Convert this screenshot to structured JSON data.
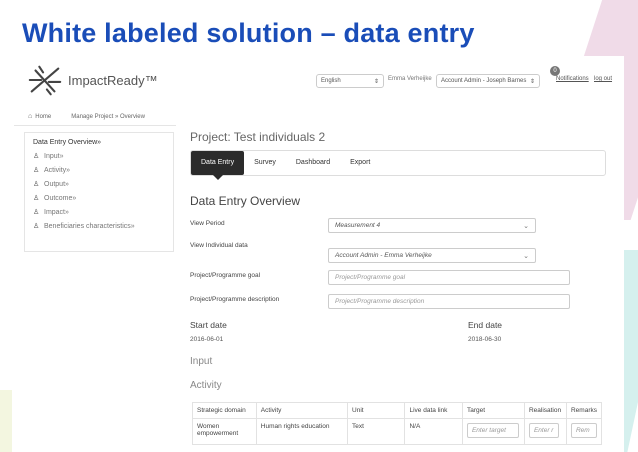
{
  "slide": {
    "title": "White labeled solution – data entry"
  },
  "colors": {
    "title": "#1a4db8",
    "active_tab": "#2b2b2b",
    "deco_pink": "#f0dbe8",
    "deco_teal": "#d5f0ee"
  },
  "header": {
    "logo_text": "ImpactReady™",
    "language": "English",
    "user_name": "Emma Verheijke",
    "role": "Account Admin - Joseph Barnes",
    "notifications_count": "0",
    "notifications_label": "Notifications",
    "logout": "log out"
  },
  "breadcrumb": {
    "home": "Home",
    "path": "Manage Project » Overview"
  },
  "sidebar": {
    "heading": "Data Entry Overview»",
    "items": [
      {
        "label": "Input»",
        "icon": "person-icon"
      },
      {
        "label": "Activity»",
        "icon": "person-icon"
      },
      {
        "label": "Output»",
        "icon": "person-icon"
      },
      {
        "label": "Outcome»",
        "icon": "person-icon"
      },
      {
        "label": "Impact»",
        "icon": "person-icon"
      },
      {
        "label": "Beneficiaries characteristics»",
        "icon": "person-icon"
      }
    ]
  },
  "main": {
    "project_title": "Project: Test individuals 2",
    "tabs": [
      {
        "label": "Data Entry",
        "active": true
      },
      {
        "label": "Survey",
        "active": false
      },
      {
        "label": "Dashboard",
        "active": false
      },
      {
        "label": "Export",
        "active": false
      }
    ],
    "section_title": "Data Entry Overview",
    "view_period": {
      "label": "View Period",
      "value": "Measurement 4"
    },
    "view_individual": {
      "label": "View Individual data",
      "value": "Account Admin - Emma Verheijke"
    },
    "goal": {
      "label": "Project/Programme goal",
      "placeholder": "Project/Programme goal"
    },
    "description": {
      "label": "Project/Programme description",
      "placeholder": "Project/Programme description"
    },
    "start_date": {
      "label": "Start date",
      "value": "2016-06-01"
    },
    "end_date": {
      "label": "End date",
      "value": "2018-06-30"
    },
    "input_heading": "Input",
    "activity_heading": "Activity",
    "activity_table": {
      "headers": [
        "Strategic domain",
        "Activity",
        "Unit",
        "Live data link",
        "Target",
        "Realisation",
        "Remarks"
      ],
      "rows": [
        {
          "strategic_domain": "Women empowerment",
          "activity": "Human rights education",
          "unit": "Text",
          "live_data_link": "N/A",
          "target_placeholder": "Enter target",
          "realisation_placeholder": "Enter r",
          "remarks_placeholder": "Rem"
        }
      ]
    }
  }
}
